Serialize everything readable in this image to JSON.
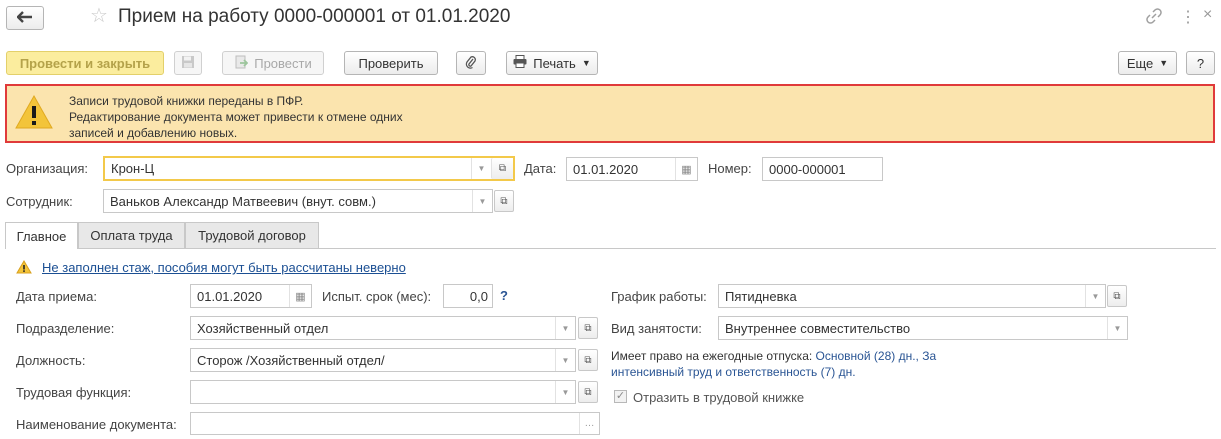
{
  "window": {
    "title": "Прием на работу 0000-000001 от 01.01.2020",
    "icons": {
      "back": "back-arrow-icon",
      "favorite": "star-icon",
      "link": "link-icon",
      "more": "kebab-icon",
      "close": "close-icon"
    }
  },
  "toolbar": {
    "post_and_close": "Провести и закрыть",
    "post": "Провести",
    "check": "Проверить",
    "print": "Печать",
    "more": "Еще",
    "help": "?"
  },
  "banner": {
    "line1": "Записи трудовой книжки переданы в ПФР.",
    "line2": "Редактирование документа может привести к отмене одних",
    "line3": "записей и добавлению новых."
  },
  "header": {
    "org_label": "Организация:",
    "org_value": "Крон-Ц",
    "date_label": "Дата:",
    "date_value": "01.01.2020",
    "number_label": "Номер:",
    "number_value": "0000-000001",
    "employee_label": "Сотрудник:",
    "employee_value": "Ваньков Александр Матвеевич (внут. совм.)"
  },
  "tabs": [
    {
      "label": "Главное",
      "active": true
    },
    {
      "label": "Оплата труда",
      "active": false
    },
    {
      "label": "Трудовой договор",
      "active": false
    }
  ],
  "main": {
    "warning_link": "Не заполнен стаж, пособия могут быть рассчитаны неверно",
    "hire_date_label": "Дата приема:",
    "hire_date_value": "01.01.2020",
    "probation_label": "Испыт. срок (мес):",
    "probation_value": "0,0",
    "probation_help": "?",
    "department_label": "Подразделение:",
    "department_value": "Хозяйственный отдел",
    "position_label": "Должность:",
    "position_value": "Сторож /Хозяйственный отдел/",
    "labor_function_label": "Трудовая функция:",
    "labor_function_value": "",
    "doc_name_label": "Наименование документа:",
    "doc_name_value": "",
    "schedule_label": "График работы:",
    "schedule_value": "Пятидневка",
    "employment_type_label": "Вид занятости:",
    "employment_type_value": "Внутреннее совместительство",
    "vacation_label": "Имеет право на ежегодные отпуска:",
    "vacation_value1": "Основной (28) дн., За",
    "vacation_value2": "интенсивный труд и ответственность (7) дн.",
    "workbook_checkbox_label": "Отразить в трудовой книжке",
    "workbook_checked": true
  }
}
